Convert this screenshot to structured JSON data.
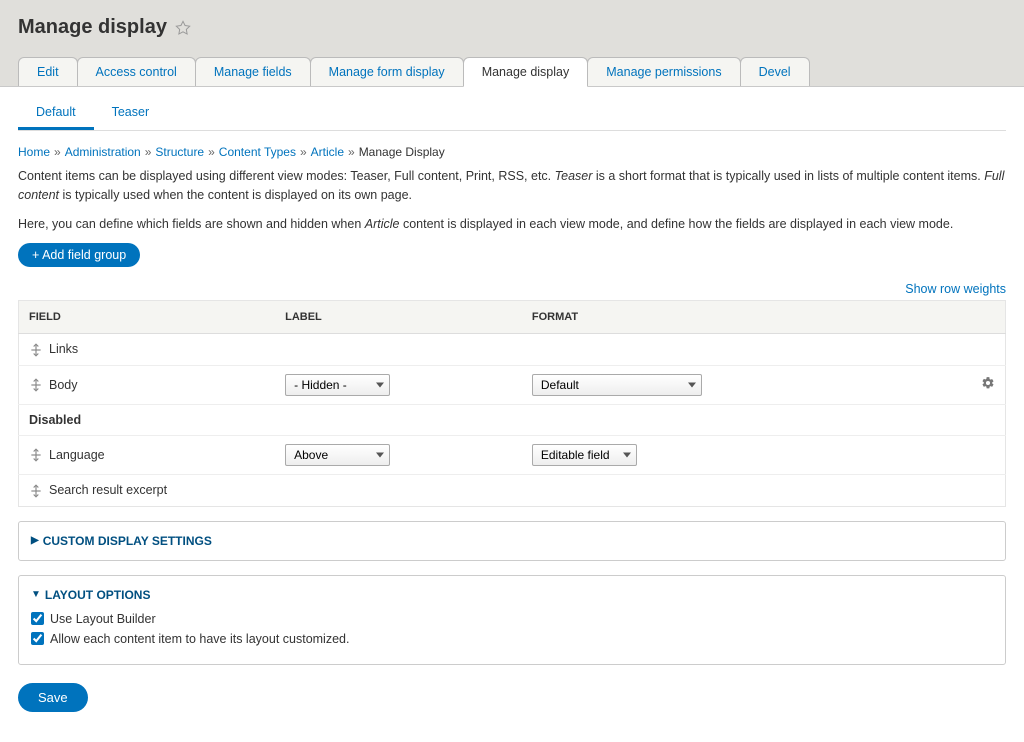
{
  "header": {
    "title": "Manage display",
    "primary_tabs": [
      {
        "label": "Edit",
        "active": false
      },
      {
        "label": "Access control",
        "active": false
      },
      {
        "label": "Manage fields",
        "active": false
      },
      {
        "label": "Manage form display",
        "active": false
      },
      {
        "label": "Manage display",
        "active": true
      },
      {
        "label": "Manage permissions",
        "active": false
      },
      {
        "label": "Devel",
        "active": false
      }
    ]
  },
  "secondary_tabs": [
    {
      "label": "Default",
      "active": true
    },
    {
      "label": "Teaser",
      "active": false
    }
  ],
  "breadcrumb": [
    {
      "label": "Home",
      "link": true
    },
    {
      "label": "Administration",
      "link": true
    },
    {
      "label": "Structure",
      "link": true
    },
    {
      "label": "Content Types",
      "link": true
    },
    {
      "label": "Article",
      "link": true
    },
    {
      "label": "Manage Display",
      "link": false
    }
  ],
  "help": {
    "p1_a": "Content items can be displayed using different view modes: Teaser, Full content, Print, RSS, etc. ",
    "p1_em1": "Teaser",
    "p1_b": " is a short format that is typically used in lists of multiple content items. ",
    "p1_em2": "Full content",
    "p1_c": " is typically used when the content is displayed on its own page.",
    "p2_a": "Here, you can define which fields are shown and hidden when ",
    "p2_em": "Article",
    "p2_b": " content is displayed in each view mode, and define how the fields are displayed in each view mode."
  },
  "buttons": {
    "add_field_group": "+ Add field group",
    "show_row_weights": "Show row weights",
    "save": "Save"
  },
  "table": {
    "headers": {
      "field": "Field",
      "label": "Label",
      "format": "Format"
    },
    "rows": [
      {
        "name": "Links",
        "label_sel": null,
        "format_sel": null,
        "gear": false
      },
      {
        "name": "Body",
        "label_sel": "- Hidden -",
        "format_sel": "Default",
        "gear": true
      }
    ],
    "disabled_heading": "Disabled",
    "disabled_rows": [
      {
        "name": "Language",
        "label_sel": "Above",
        "format_sel": "Editable field",
        "gear": false,
        "narrow_format": true
      },
      {
        "name": "Search result excerpt",
        "label_sel": null,
        "format_sel": null,
        "gear": false
      }
    ]
  },
  "details": {
    "custom_display": "Custom display settings",
    "layout_options": "Layout options",
    "layout_cb1": "Use Layout Builder",
    "layout_cb2": "Allow each content item to have its layout customized."
  }
}
